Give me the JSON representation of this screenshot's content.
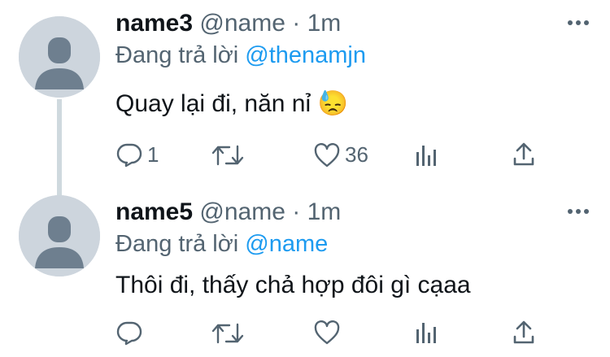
{
  "tweets": [
    {
      "display_name": "name3",
      "handle": "@name",
      "separator": "·",
      "time": "1m",
      "reply_prefix": "Đang trả lời",
      "reply_to": "@thenamjn",
      "text": "Quay lại đi, năn nỉ 😓",
      "actions": {
        "reply_count": "1",
        "retweet_count": "",
        "like_count": "36"
      },
      "icons": [
        "reply-icon",
        "retweet-icon",
        "like-icon",
        "analytics-icon",
        "share-icon",
        "more-icon"
      ]
    },
    {
      "display_name": "name5",
      "handle": "@name",
      "separator": "·",
      "time": "1m",
      "reply_prefix": "Đang trả lời",
      "reply_to": "@name",
      "text": "Thôi đi, thấy chả hợp đôi gì cạaa",
      "actions": {
        "reply_count": "",
        "retweet_count": "",
        "like_count": ""
      },
      "icons": [
        "reply-icon",
        "retweet-icon",
        "like-icon",
        "analytics-icon",
        "share-icon",
        "more-icon"
      ]
    }
  ],
  "colors": {
    "accent": "#1d9bf0",
    "secondary_text": "#536471",
    "avatar_bg": "#cdd5dd",
    "avatar_fg": "#6e7f8f"
  }
}
